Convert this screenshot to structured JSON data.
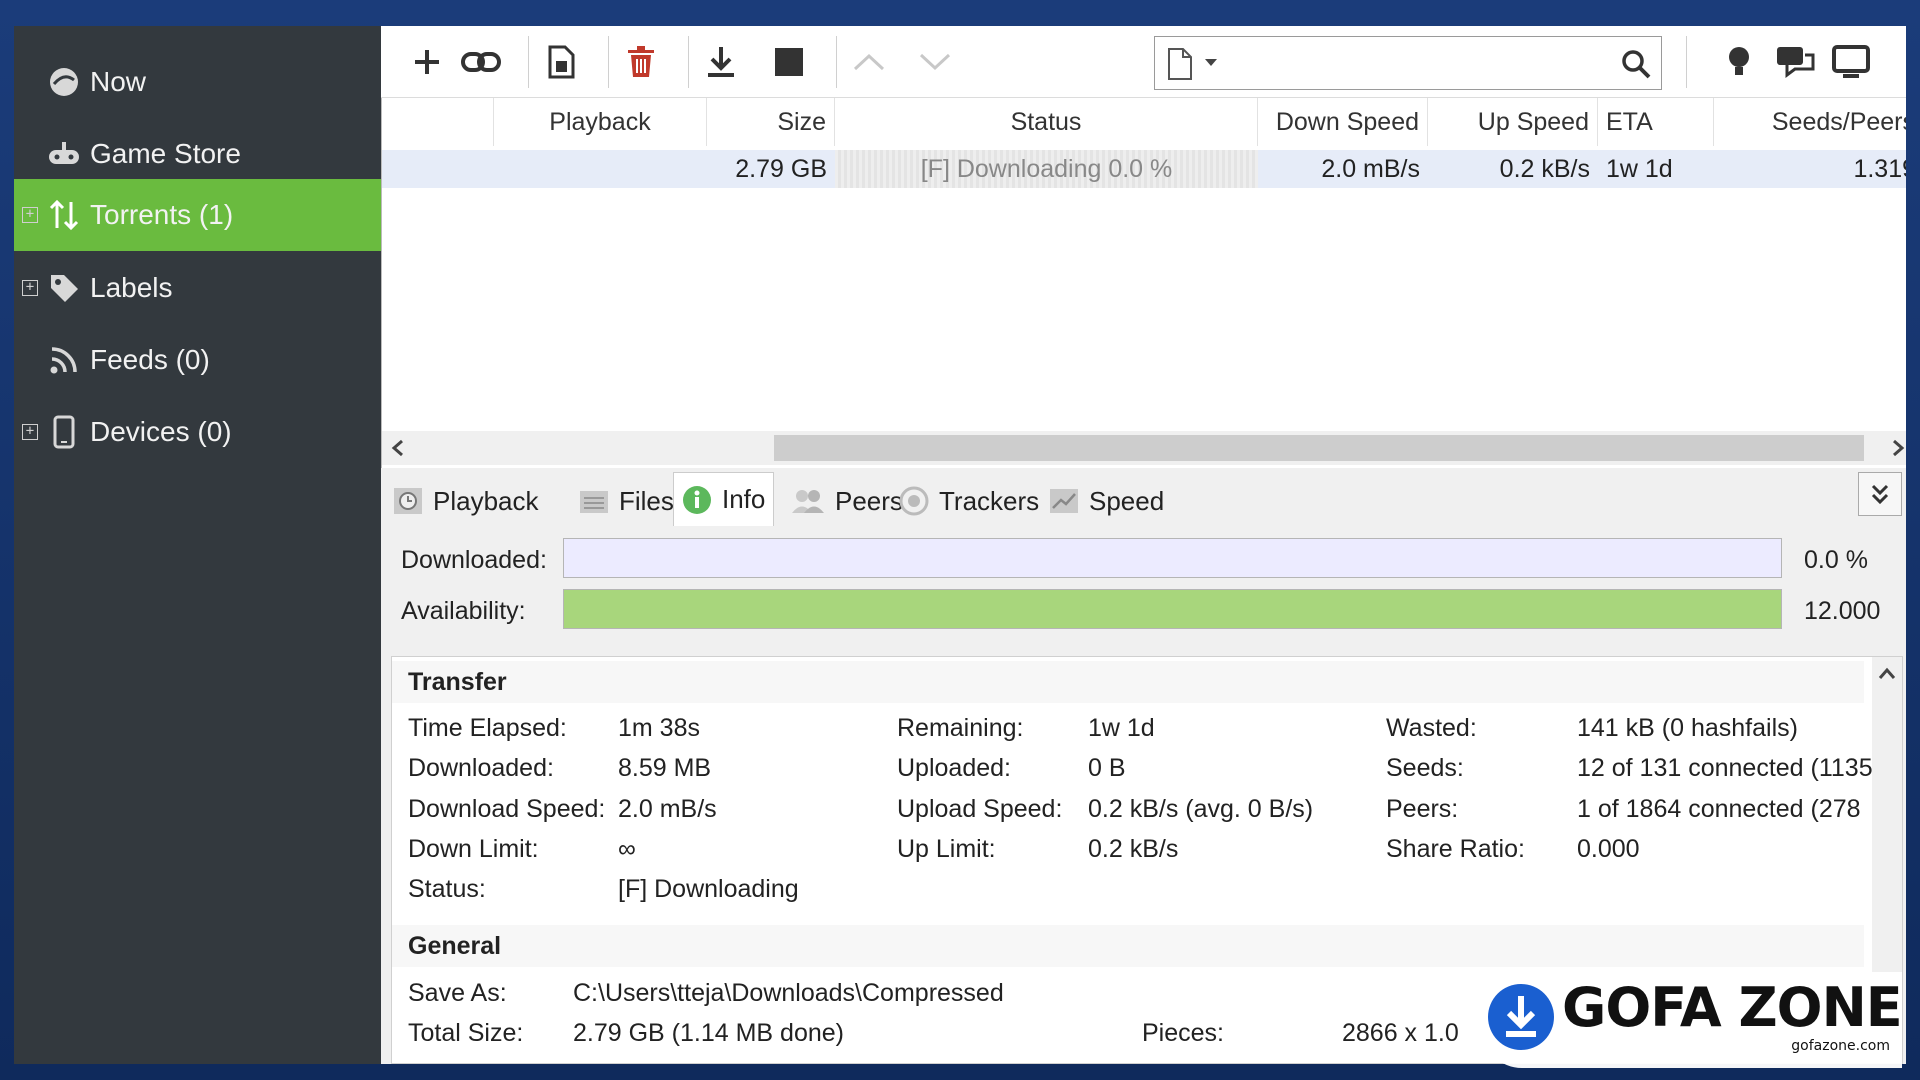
{
  "sidebar": {
    "items": [
      {
        "label": "Now",
        "icon": "now-icon",
        "expandable": false,
        "active": false
      },
      {
        "label": "Game Store",
        "icon": "game-controller-icon",
        "expandable": false,
        "active": false
      },
      {
        "label": "Torrents (1)",
        "icon": "torrent-arrows-icon",
        "expandable": true,
        "active": true
      },
      {
        "label": "Labels",
        "icon": "tag-icon",
        "expandable": true,
        "active": false
      },
      {
        "label": "Feeds (0)",
        "icon": "rss-icon",
        "expandable": false,
        "active": false
      },
      {
        "label": "Devices (0)",
        "icon": "phone-icon",
        "expandable": true,
        "active": false
      }
    ],
    "expander": "+"
  },
  "list": {
    "columns": [
      "Playback",
      "Size",
      "Status",
      "Down Speed",
      "Up Speed",
      "ETA",
      "Seeds/Peers"
    ],
    "row": {
      "size": "2.79 GB",
      "status": "[F] Downloading 0.0 %",
      "down_speed": "2.0 mB/s",
      "up_speed": "0.2 kB/s",
      "eta": "1w 1d",
      "seeds_peers": "1.319"
    }
  },
  "tabs": [
    {
      "label": "Playback",
      "icon": "playback-icon",
      "active": false
    },
    {
      "label": "Files",
      "icon": "files-icon",
      "active": false
    },
    {
      "label": "Info",
      "icon": "info-icon",
      "active": true
    },
    {
      "label": "Peers",
      "icon": "peers-icon",
      "active": false
    },
    {
      "label": "Trackers",
      "icon": "trackers-icon",
      "active": false
    },
    {
      "label": "Speed",
      "icon": "speed-icon",
      "active": false
    }
  ],
  "info": {
    "downloaded_label": "Downloaded:",
    "downloaded_value": "0.0 %",
    "downloaded_fraction": 0.0,
    "availability_label": "Availability:",
    "availability_value": "12.000",
    "availability_fraction": 1.0,
    "transfer": {
      "title": "Transfer",
      "col1": [
        {
          "k": "Time Elapsed:",
          "v": "1m 38s"
        },
        {
          "k": "Downloaded:",
          "v": "8.59 MB"
        },
        {
          "k": "Download Speed:",
          "v": "2.0 mB/s"
        },
        {
          "k": "Down Limit:",
          "v": "∞"
        },
        {
          "k": "Status:",
          "v": "[F] Downloading"
        }
      ],
      "col2": [
        {
          "k": "Remaining:",
          "v": "1w 1d"
        },
        {
          "k": "Uploaded:",
          "v": "0 B"
        },
        {
          "k": "Upload Speed:",
          "v": "0.2 kB/s (avg. 0 B/s)"
        },
        {
          "k": "Up Limit:",
          "v": "0.2 kB/s"
        }
      ],
      "col3": [
        {
          "k": "Wasted:",
          "v": "141 kB (0 hashfails)"
        },
        {
          "k": "Seeds:",
          "v": "12 of 131 connected (1135"
        },
        {
          "k": "Peers:",
          "v": "1 of 1864 connected (278"
        },
        {
          "k": "Share Ratio:",
          "v": "0.000"
        }
      ]
    },
    "general": {
      "title": "General",
      "save_as_label": "Save As:",
      "save_as_value": "C:\\Users\\tteja\\Downloads\\Compressed",
      "total_size_label": "Total Size:",
      "total_size_value": "2.79 GB (1.14 MB done)",
      "pieces_label": "Pieces:",
      "pieces_value": "2866 x 1.0"
    }
  },
  "watermark": {
    "brand": "GOFA ZONE",
    "url": "gofazone.com"
  },
  "colors": {
    "sidebar_bg": "#33393e",
    "active_green": "#6abb3f",
    "availability_bar": "#a8d67c",
    "delete_red": "#c0392b",
    "watermark_blue": "#1a5fd0"
  }
}
